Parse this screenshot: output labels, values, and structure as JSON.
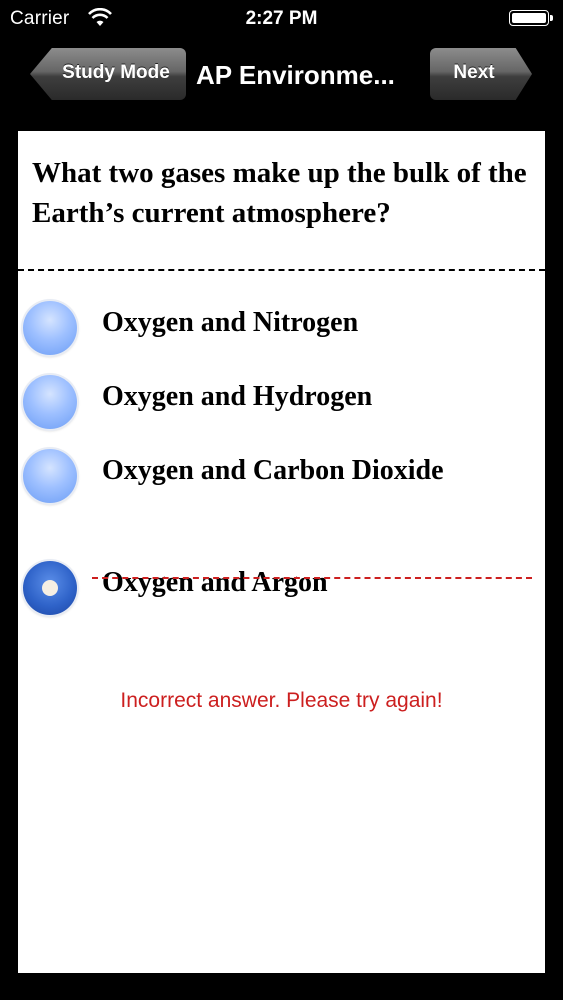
{
  "status_bar": {
    "carrier": "Carrier",
    "time": "2:27 PM",
    "wifi_icon": "wifi-icon",
    "battery_icon": "battery-icon"
  },
  "nav": {
    "back_label": "Study Mode",
    "title": "AP Environme...",
    "next_label": "Next"
  },
  "question": "What two gases make up the bulk of the Earth’s current atmosphere?",
  "options": [
    {
      "label": "Oxygen and Nitrogen",
      "selected": false
    },
    {
      "label": "Oxygen and Hydrogen",
      "selected": false
    },
    {
      "label": "Oxygen and Carbon Dioxide",
      "selected": false
    },
    {
      "label": "Oxygen and Argon",
      "selected": true,
      "struck_through": true
    }
  ],
  "feedback": "Incorrect answer. Please try again!",
  "colors": {
    "error": "#cc1f1f",
    "radio": "#6a9cf5",
    "radio_selected": "#2f63c9"
  }
}
